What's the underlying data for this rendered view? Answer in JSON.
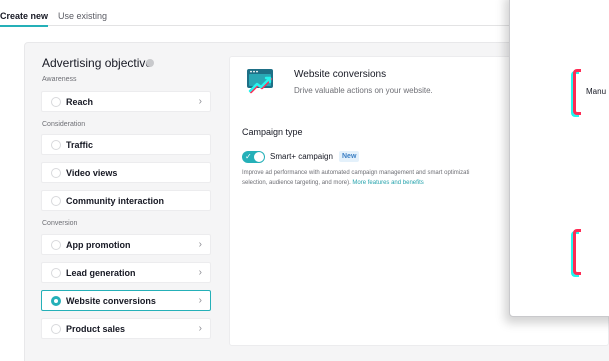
{
  "tabs": [
    {
      "label": "Create new",
      "active": true
    },
    {
      "label": "Use existing",
      "active": false
    }
  ],
  "objective": {
    "title": "Advertising objective",
    "groups": [
      {
        "label": "Awareness",
        "options": [
          {
            "label": "Reach",
            "has_chevron": true
          }
        ]
      },
      {
        "label": "Consideration",
        "options": [
          {
            "label": "Traffic",
            "has_chevron": false
          },
          {
            "label": "Video views",
            "has_chevron": false
          },
          {
            "label": "Community interaction",
            "has_chevron": false
          }
        ]
      },
      {
        "label": "Conversion",
        "options": [
          {
            "label": "App promotion",
            "has_chevron": true
          },
          {
            "label": "Lead generation",
            "has_chevron": true
          },
          {
            "label": "Website conversions",
            "has_chevron": true,
            "selected": true
          },
          {
            "label": "Product sales",
            "has_chevron": true
          }
        ]
      }
    ]
  },
  "detail": {
    "title": "Website conversions",
    "subtitle": "Drive valuable actions on your website.",
    "campaign_type_label": "Campaign type",
    "smart_label": "Smart+ campaign",
    "smart_enabled": true,
    "badge": "New",
    "description_line1": "Improve ad performance with automated campaign management and smart optimizati",
    "description_line2": "selection, audience targeting, and more).",
    "description_link": "More features and benefits"
  },
  "overlay": {
    "text": "Manu"
  },
  "colors": {
    "accent": "#25b0b8",
    "badge_bg": "#e4f1fb",
    "badge_text": "#3b7fc4",
    "brand_red": "#fe2c55",
    "brand_cyan": "#25f4ee"
  },
  "icons": {
    "info": "info-circle-icon",
    "chevron": "chevron-right-icon",
    "conversion": "trending-up-browser-icon",
    "check": "check-icon"
  }
}
